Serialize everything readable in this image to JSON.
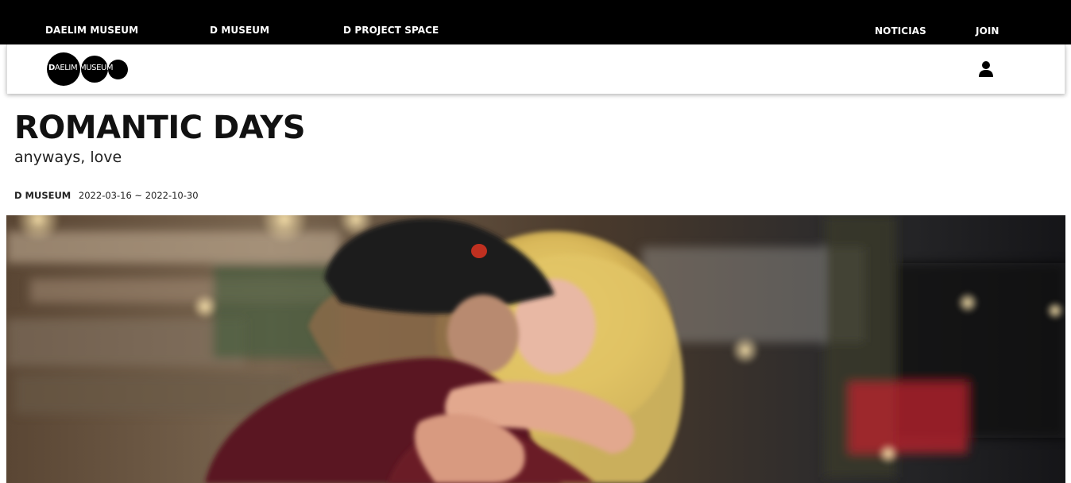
{
  "topnav": {
    "items": [
      {
        "label": "DAELIM MUSEUM"
      },
      {
        "label": "D MUSEUM"
      },
      {
        "label": "D PROJECT SPACE"
      }
    ],
    "noticias": "NOTICIAS",
    "join": "JOIN"
  },
  "header": {
    "logo_initial": "D",
    "logo_rest": "AELIM MUSEUM",
    "user_icon": "user-icon"
  },
  "exhibition": {
    "title": "ROMANTIC DAYS",
    "subtitle": "anyways, love",
    "venue": "D MUSEUM",
    "dates": "2022-03-16 ~ 2022-10-30"
  },
  "colors": {
    "topbar_bg": "#000000",
    "topbar_text": "#ffffff",
    "text": "#111111"
  }
}
